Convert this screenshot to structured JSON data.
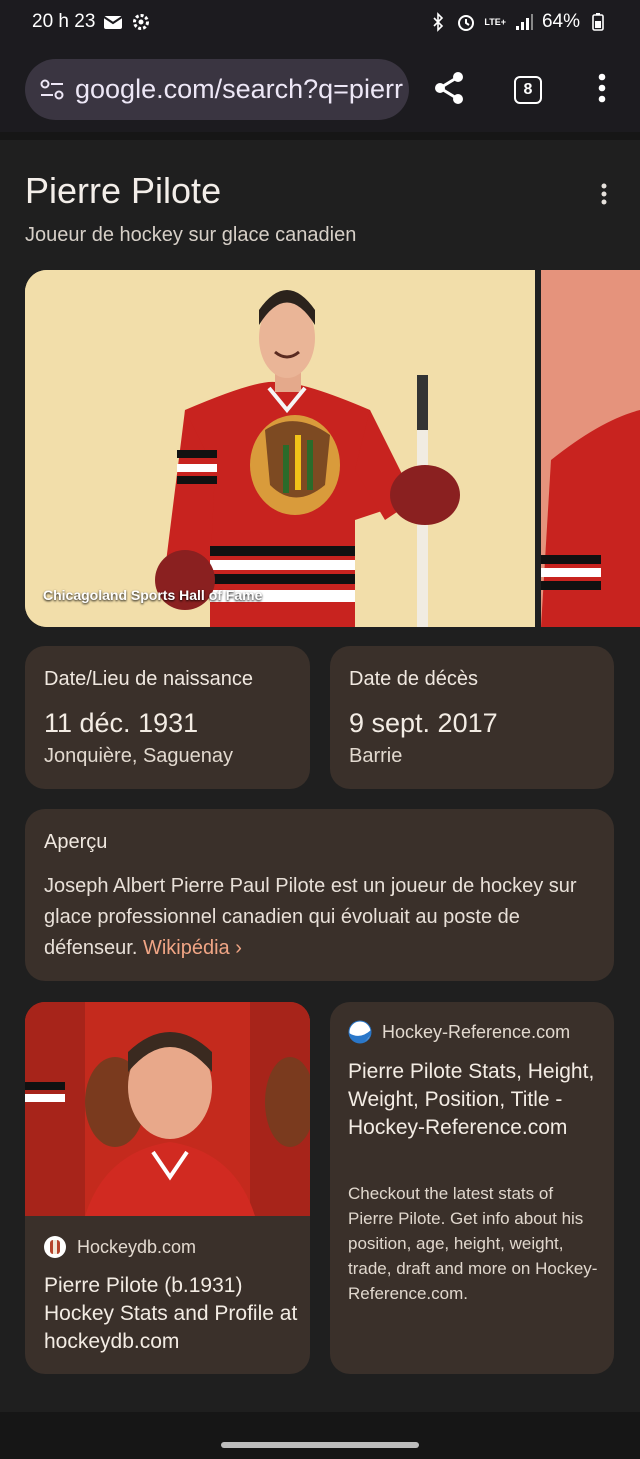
{
  "status_bar": {
    "time": "20 h 23",
    "battery": "64%",
    "network": "LTE+"
  },
  "browser": {
    "url": "google.com/search?q=pierr",
    "tab_count": "8"
  },
  "knowledge_panel": {
    "title": "Pierre Pilote",
    "subtitle": "Joueur de hockey sur glace canadien",
    "image_credit": "Chicagoland Sports Hall of Fame",
    "birth": {
      "label": "Date/Lieu de naissance",
      "date": "11 déc. 1931",
      "place": "Jonquière, Saguenay"
    },
    "death": {
      "label": "Date de décès",
      "date": "9 sept. 2017",
      "place": "Barrie"
    },
    "overview": {
      "label": "Aperçu",
      "text": "Joseph Albert Pierre Paul Pilote est un joueur de hockey sur glace professionnel canadien qui évoluait au poste de défenseur.",
      "link_text": "Wikipédia",
      "chevron": "›"
    }
  },
  "results": [
    {
      "source": "Hockeydb.com",
      "title": "Pierre Pilote (b.1931) Hockey Stats and Profile at hockeydb.com"
    },
    {
      "source": "Hockey-Reference.com",
      "title": "Pierre Pilote Stats, Height, Weight, Position, Title - Hockey-Reference.com",
      "description": "Checkout the latest stats of Pierre Pilote. Get info about his position, age, height, weight, trade, draft and more on Hockey-Reference.com."
    }
  ],
  "colors": {
    "card_bg": "#3a302a",
    "page_bg": "#1f1f1f",
    "link": "#f0a585",
    "jersey_red": "#c8231f"
  }
}
